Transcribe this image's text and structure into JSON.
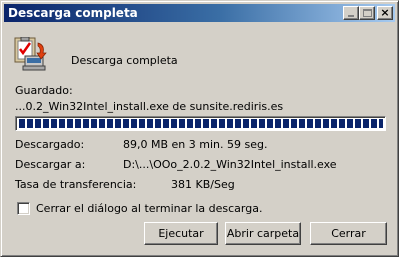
{
  "window": {
    "title": "Descarga completa",
    "minimize_icon": "minimize-icon",
    "maximize_icon": "maximize-icon",
    "close_icon": "close-icon"
  },
  "header": {
    "icon": "download-complete-icon",
    "label": "Descarga completa"
  },
  "saved": {
    "label": "Guardado:",
    "value": "...0.2_Win32Intel_install.exe de sunsite.rediris.es"
  },
  "progress": {
    "percent": 100
  },
  "details": {
    "downloaded_label": "Descargado:",
    "downloaded_value": "89,0 MB en 3 min. 59 seg.",
    "download_to_label": "Descargar a:",
    "download_to_value": "D:\\...\\OOo_2.0.2_Win32Intel_install.exe",
    "rate_label": "Tasa de transferencia:",
    "rate_value": "381 KB/Seg"
  },
  "close_when_done": {
    "label": "Cerrar el diálogo al terminar la descarga.",
    "checked": false
  },
  "buttons": {
    "run": "Ejecutar",
    "open_folder": "Abrir carpeta",
    "close": "Cerrar"
  }
}
